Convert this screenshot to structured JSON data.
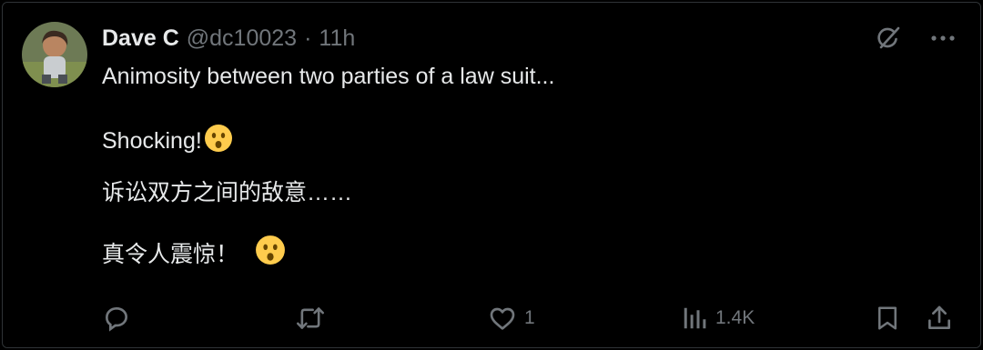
{
  "tweet": {
    "author_name": "Dave C",
    "handle": "@dc10023",
    "separator": "·",
    "time": "11h",
    "lines": {
      "l1": "Animosity between two parties of a law suit...",
      "l2": "Shocking!",
      "l3": "诉讼双方之间的敌意……",
      "l4": "真令人震惊！"
    },
    "emojis": [
      "astonished-face",
      "astonished-face"
    ]
  },
  "actions": {
    "reply_count": "",
    "retweet_count": "",
    "like_count": "1",
    "views_count": "1.4K"
  },
  "colors": {
    "background": "#000000",
    "text": "#e7e9ea",
    "muted": "#71767b",
    "border": "#2f3336",
    "emoji": "#ffcc4d"
  },
  "icons": [
    "grok-icon",
    "more-icon",
    "reply-icon",
    "retweet-icon",
    "like-icon",
    "views-icon",
    "bookmark-icon",
    "share-icon"
  ]
}
